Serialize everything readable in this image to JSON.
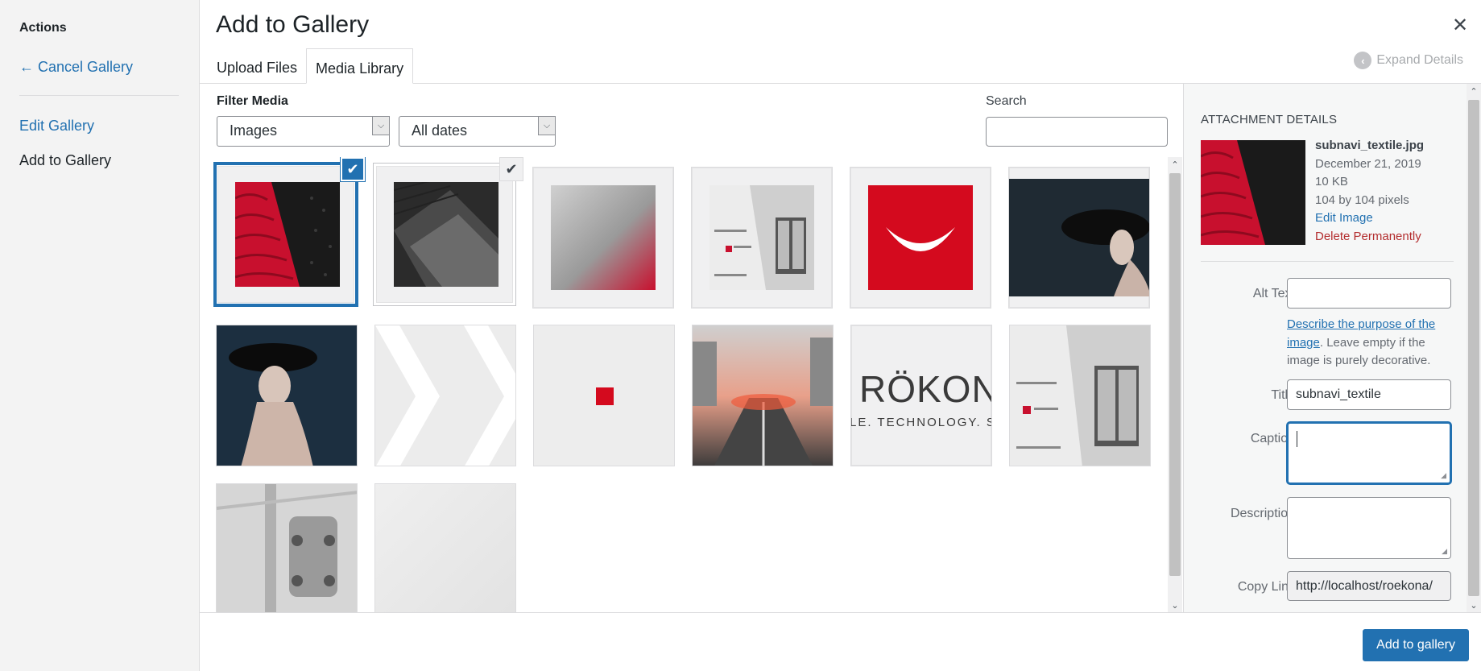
{
  "menu": {
    "heading": "Actions",
    "cancel": "← Cancel Gallery",
    "edit_gallery": "Edit Gallery",
    "add_to_gallery": "Add to Gallery"
  },
  "frame": {
    "title": "Add to Gallery",
    "close": "✕",
    "expand_details": "Expand Details",
    "tabs": [
      "Upload Files",
      "Media Library"
    ]
  },
  "toolbar": {
    "filter_label": "Filter Media",
    "type_filter": "Images",
    "date_filter": "All dates",
    "search_label": "Search",
    "search_value": ""
  },
  "attachments": [
    {
      "name": "subnavi_textile",
      "selected": true,
      "check": "blue"
    },
    {
      "name": "dark-tech-texture",
      "check": "gray"
    },
    {
      "name": "red-blur-fabric"
    },
    {
      "name": "building-facade"
    },
    {
      "name": "red-smile-logo"
    },
    {
      "name": "fashion-portrait-dark"
    },
    {
      "name": "fashion-portrait-hat"
    },
    {
      "name": "white-chevron"
    },
    {
      "name": "red-square"
    },
    {
      "name": "city-traffic"
    },
    {
      "name": "rokona-logo"
    },
    {
      "name": "building-facade-2"
    },
    {
      "name": "machine-part"
    },
    {
      "name": "light-gray-blank"
    }
  ],
  "rokona_logo_text": {
    "big": "RÖKON",
    "small": "LE. TECHNOLOGY. SOLU"
  },
  "details": {
    "heading": "ATTACHMENT DETAILS",
    "filename": "subnavi_textile.jpg",
    "date": "December 21, 2019",
    "size": "10 KB",
    "dimensions": "104 by 104 pixels",
    "edit_image": "Edit Image",
    "delete_permanently": "Delete Permanently",
    "alt_text_label": "Alt Text",
    "alt_text_value": "",
    "alt_help_link": "Describe the purpose of the image",
    "alt_help_rest": ". Leave empty if the image is purely decorative.",
    "title_label": "Title",
    "title_value": "subnavi_textile",
    "caption_label": "Caption",
    "caption_value": "",
    "description_label": "Description",
    "description_value": "",
    "copy_link_label": "Copy Link",
    "copy_link_value": "http://localhost/roekona/"
  },
  "footer": {
    "primary_button": "Add to gallery"
  },
  "colors": {
    "accent": "#2271b1",
    "danger": "#b32d2e",
    "brand_red": "#d40a1e"
  }
}
